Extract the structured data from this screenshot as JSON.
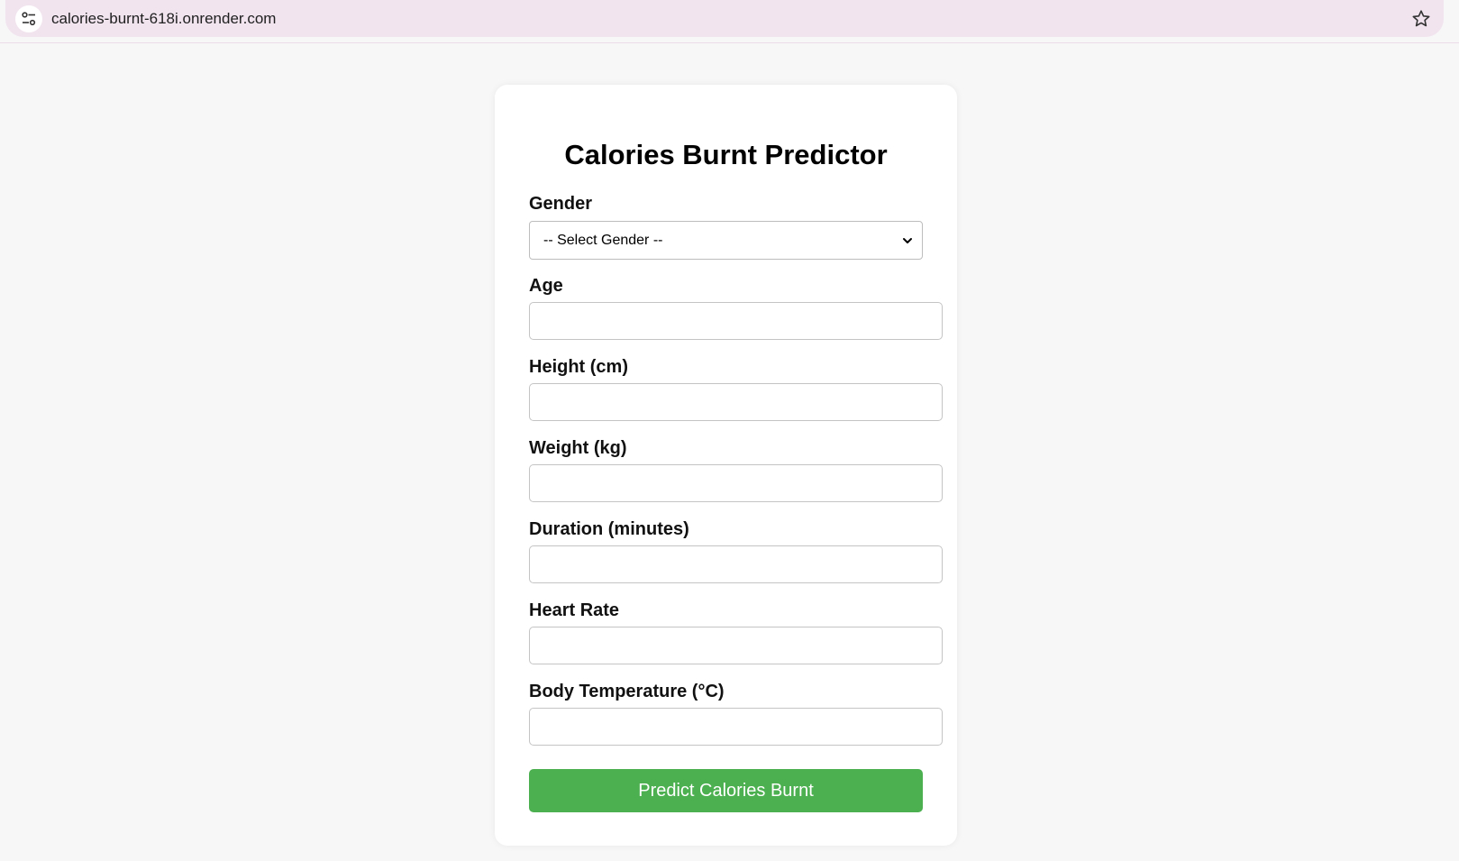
{
  "browser": {
    "url": "calories-burnt-618i.onrender.com"
  },
  "form": {
    "title": "Calories Burnt Predictor",
    "gender": {
      "label": "Gender",
      "selected": "-- Select Gender --"
    },
    "fields": [
      {
        "label": "Age",
        "value": ""
      },
      {
        "label": "Height (cm)",
        "value": ""
      },
      {
        "label": "Weight (kg)",
        "value": ""
      },
      {
        "label": "Duration (minutes)",
        "value": ""
      },
      {
        "label": "Heart Rate",
        "value": ""
      },
      {
        "label": "Body Temperature (°C)",
        "value": ""
      }
    ],
    "submit_label": "Predict Calories Burnt"
  },
  "colors": {
    "accent": "#4caf50",
    "omnibox": "#f1e4ef",
    "page_bg": "#f7f7f7"
  },
  "icons": {
    "site_info": "tune-icon",
    "bookmark": "star-icon",
    "dropdown": "chevron-down-icon"
  }
}
